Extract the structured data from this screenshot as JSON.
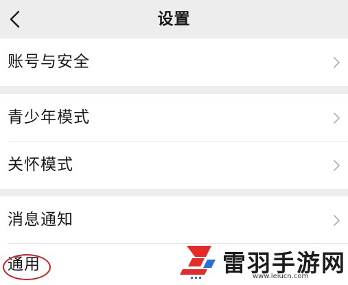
{
  "header": {
    "title": "设置",
    "back_icon": "chevron-left-icon"
  },
  "sections": [
    {
      "items": [
        {
          "label": "账号与安全"
        }
      ]
    },
    {
      "items": [
        {
          "label": "青少年模式"
        },
        {
          "label": "关怀模式"
        }
      ]
    },
    {
      "items": [
        {
          "label": "消息通知"
        },
        {
          "label": "通用"
        }
      ]
    }
  ],
  "row_chevron_icon": "chevron-right-icon",
  "highlight": {
    "target": "通用",
    "color": "#c81e1e"
  },
  "watermark": {
    "name": "雷羽手游网",
    "url": "www.leiucn.com",
    "logo_colors": [
      "#e52a2a",
      "#2b6fd6"
    ]
  },
  "colors": {
    "background": "#ededed",
    "row_background": "#ffffff",
    "text": "#181818",
    "chevron": "#b2b2b2"
  }
}
